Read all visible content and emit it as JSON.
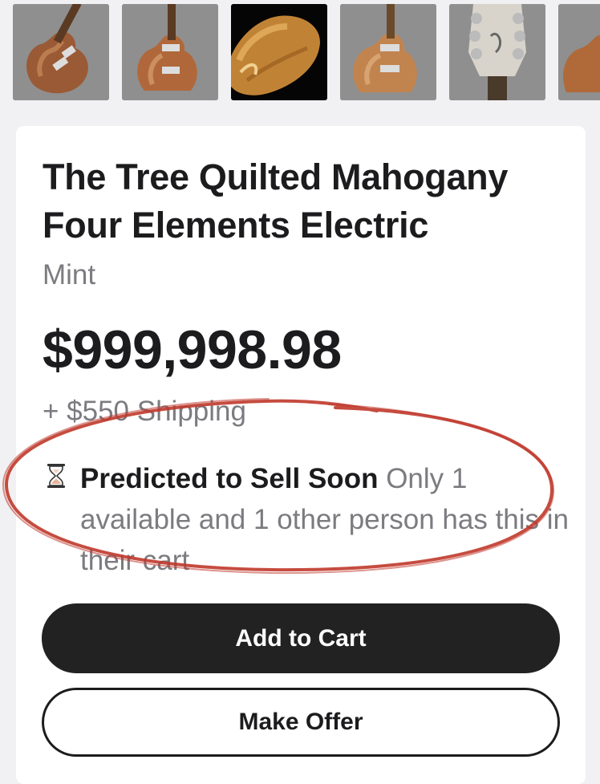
{
  "gallery": {
    "thumbnails": [
      {
        "icon": "guitar-body-photo"
      },
      {
        "icon": "guitar-body-photo"
      },
      {
        "icon": "guitar-body-photo-selected"
      },
      {
        "icon": "guitar-body-photo"
      },
      {
        "icon": "guitar-headstock-photo"
      },
      {
        "icon": "guitar-body-photo"
      }
    ]
  },
  "product": {
    "title": "The Tree Quilted Mahogany Four Elements Electric",
    "condition": "Mint",
    "price": "$999,998.98",
    "shipping": "+ $550 Shipping"
  },
  "availability": {
    "icon": "hourglass-icon",
    "headline": "Predicted to Sell Soon",
    "detail": "Only 1 available and 1 other person has this in their cart"
  },
  "actions": {
    "add_to_cart": "Add to Cart",
    "make_offer": "Make Offer"
  },
  "colors": {
    "primary_button": "#222222",
    "annotation_circle": "#c0392b",
    "muted_text": "#7b7b80"
  }
}
